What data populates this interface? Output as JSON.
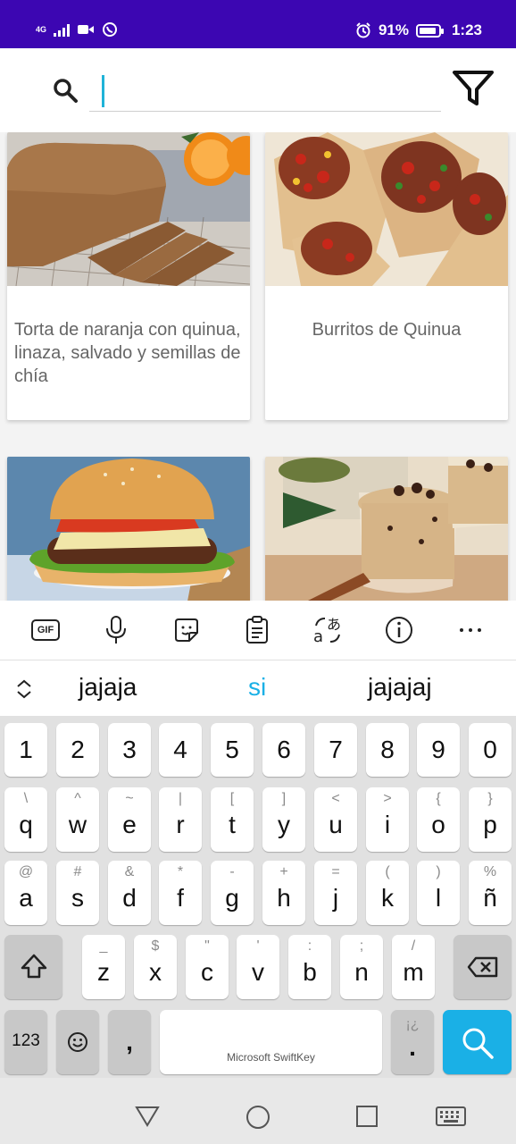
{
  "status_bar": {
    "network_label": "4G",
    "battery": "91%",
    "time": "1:23",
    "icons": [
      "network-icon",
      "signal-icon",
      "video-icon",
      "whatsapp-icon",
      "alarm-icon",
      "battery-icon"
    ]
  },
  "search": {
    "value": "",
    "placeholder": ""
  },
  "cards": [
    {
      "title": "Torta de naranja con quinua, linaza, salvado y semillas de chía"
    },
    {
      "title": "Burritos de Quinua"
    },
    {
      "title": ""
    },
    {
      "title": ""
    }
  ],
  "keyboard_toolbar": {
    "gif_label": "GIF",
    "icons": [
      "gif-icon",
      "microphone-icon",
      "sticker-icon",
      "clipboard-icon",
      "translate-icon",
      "info-icon",
      "more-icon"
    ]
  },
  "suggestions": {
    "items": [
      "jajaja",
      "si",
      "jajajaj"
    ],
    "highlight_color": "#1ab0e6"
  },
  "keyboard": {
    "row_numbers": [
      "1",
      "2",
      "3",
      "4",
      "5",
      "6",
      "7",
      "8",
      "9",
      "0"
    ],
    "row1": [
      {
        "main": "q",
        "alt": "\\"
      },
      {
        "main": "w",
        "alt": "^"
      },
      {
        "main": "e",
        "alt": "~"
      },
      {
        "main": "r",
        "alt": "|"
      },
      {
        "main": "t",
        "alt": "["
      },
      {
        "main": "y",
        "alt": "]"
      },
      {
        "main": "u",
        "alt": "<"
      },
      {
        "main": "i",
        "alt": ">"
      },
      {
        "main": "o",
        "alt": "{"
      },
      {
        "main": "p",
        "alt": "}"
      }
    ],
    "row2": [
      {
        "main": "a",
        "alt": "@"
      },
      {
        "main": "s",
        "alt": "#"
      },
      {
        "main": "d",
        "alt": "&"
      },
      {
        "main": "f",
        "alt": "*"
      },
      {
        "main": "g",
        "alt": "-"
      },
      {
        "main": "h",
        "alt": "+"
      },
      {
        "main": "j",
        "alt": "="
      },
      {
        "main": "k",
        "alt": "("
      },
      {
        "main": "l",
        "alt": ")"
      },
      {
        "main": "ñ",
        "alt": "%"
      }
    ],
    "row3": [
      {
        "main": "z",
        "alt": "_"
      },
      {
        "main": "x",
        "alt": "$"
      },
      {
        "main": "c",
        "alt": "\""
      },
      {
        "main": "v",
        "alt": "'"
      },
      {
        "main": "b",
        "alt": ":"
      },
      {
        "main": "n",
        "alt": ";"
      },
      {
        "main": "m",
        "alt": "/"
      }
    ],
    "numbers_label": "123",
    "comma_label": ",",
    "space_label": "Microsoft SwiftKey",
    "period_label": ".",
    "period_alt": "¡¿",
    "accent_color": "#1ab0e6"
  },
  "navbar": {
    "icons": [
      "back-icon",
      "home-icon",
      "recents-icon",
      "keyboard-icon"
    ]
  }
}
